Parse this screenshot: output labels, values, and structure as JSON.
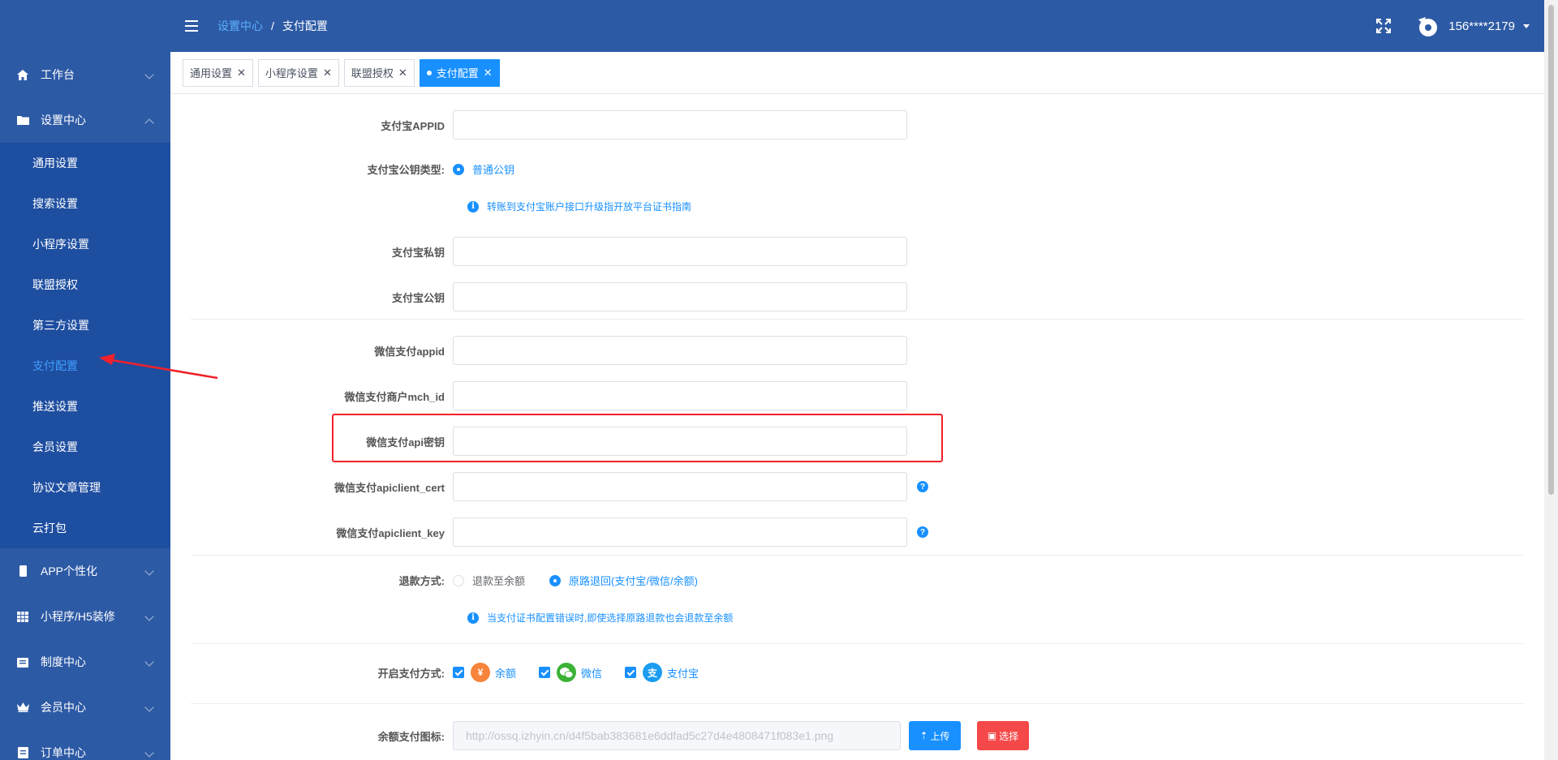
{
  "header": {
    "breadcrumb_parent": "设置中心",
    "breadcrumb_sep": "/",
    "breadcrumb_current": "支付配置",
    "user_name": "156****2179"
  },
  "sidebar": {
    "items": [
      {
        "label": "工作台",
        "icon": "home-icon"
      },
      {
        "label": "设置中心",
        "icon": "folder-icon"
      },
      {
        "label": "APP个性化",
        "icon": "phone-icon"
      },
      {
        "label": "小程序/H5装修",
        "icon": "grid-icon"
      },
      {
        "label": "制度中心",
        "icon": "document-icon"
      },
      {
        "label": "会员中心",
        "icon": "crown-icon"
      },
      {
        "label": "订单中心",
        "icon": "order-icon"
      }
    ],
    "sub_items": [
      "通用设置",
      "搜索设置",
      "小程序设置",
      "联盟授权",
      "第三方设置",
      "支付配置",
      "推送设置",
      "会员设置",
      "协议文章管理",
      "云打包"
    ]
  },
  "tabs": [
    {
      "label": "通用设置"
    },
    {
      "label": "小程序设置"
    },
    {
      "label": "联盟授权"
    },
    {
      "label": "支付配置"
    }
  ],
  "form": {
    "alipay_appid_label": "支付宝APPID",
    "alipay_key_type_label": "支付宝公钥类型:",
    "alipay_key_type_option": "普通公钥",
    "alipay_hint": "转账到支付宝账户接口升级指开放平台证书指南",
    "alipay_private_key_label": "支付宝私钥",
    "alipay_public_key_label": "支付宝公钥",
    "wechat_appid_label": "微信支付appid",
    "wechat_mch_id_label": "微信支付商户mch_id",
    "wechat_api_key_label": "微信支付api密钥",
    "wechat_cert_label": "微信支付apiclient_cert",
    "wechat_key_label": "微信支付apiclient_key",
    "refund_label": "退款方式:",
    "refund_opt1": "退款至余额",
    "refund_opt2": "原路退回(支付宝/微信/余额)",
    "refund_hint": "当支付证书配置错误时,即使选择原路退款也会退款至余额",
    "pay_methods_label": "开启支付方式:",
    "pay_balance": "余额",
    "pay_balance_icon": "¥",
    "pay_wechat": "微信",
    "pay_alipay": "支付宝",
    "pay_alipay_icon": "支",
    "balance_icon_label": "余额支付图标:",
    "balance_icon_url": "http://ossq.izhyin.cn/d4f5bab383681e6ddfad5c27d4e4808471f083e1.png",
    "upload_btn": "上传",
    "select_btn": "选择",
    "help_glyph": "?",
    "info_glyph": "i"
  },
  "colors": {
    "primary": "#1890ff",
    "sidebar_bg": "#2d5aa5",
    "submenu_bg": "#1e4ea0",
    "highlight": "#f0212a"
  }
}
